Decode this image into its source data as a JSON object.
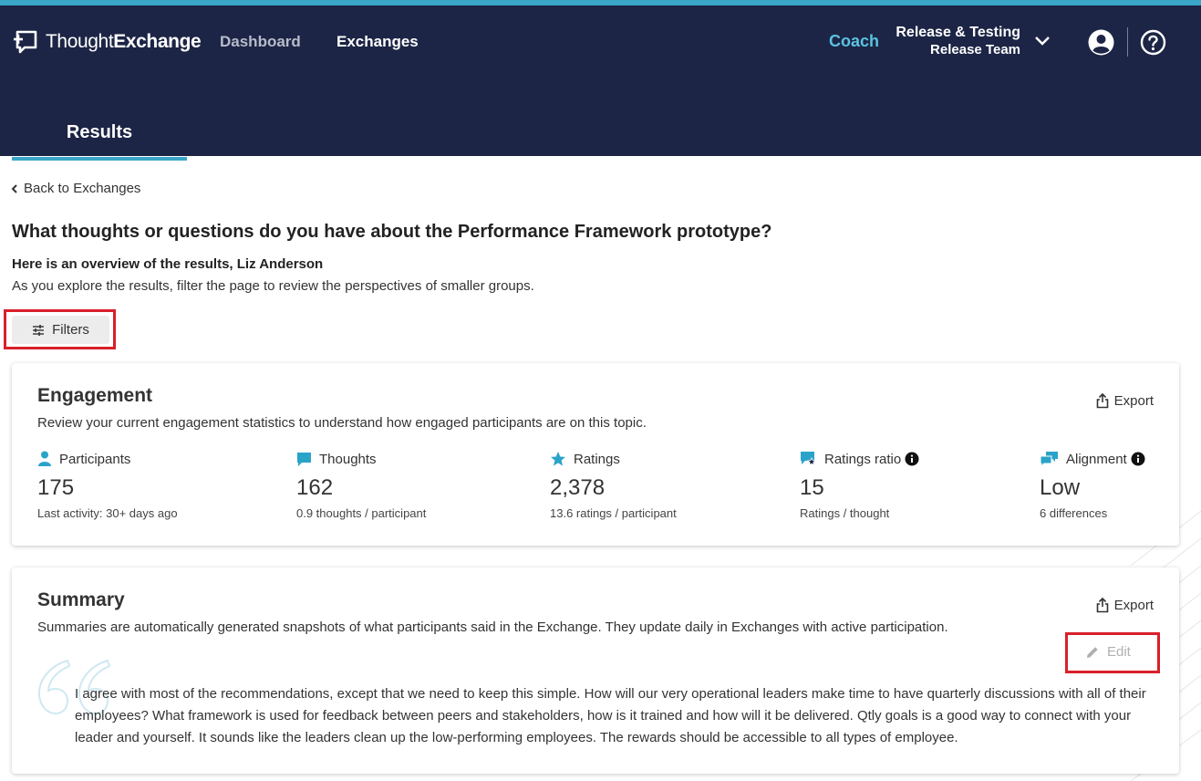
{
  "colors": {
    "header_bg": "#1c2545",
    "accent": "#3aa7c9",
    "coach": "#5cc1e0",
    "icon_accent": "#2aa3c9",
    "highlight_red": "#d9202a"
  },
  "header": {
    "logo_light": "Thought",
    "logo_bold": "Exchange",
    "nav": {
      "dashboard": "Dashboard",
      "exchanges": "Exchanges"
    },
    "coach": "Coach",
    "org_name": "Release & Testing",
    "team_name": "Release Team",
    "icons": {
      "logo": "thoughtexchange-logo-icon",
      "chevron": "chevron-down-icon",
      "user": "user-circle-icon",
      "help": "help-circle-icon"
    }
  },
  "tabs": {
    "results": "Results"
  },
  "back_link": "Back to Exchanges",
  "page_title": "What thoughts or questions do you have about the Performance Framework prototype?",
  "overview": {
    "title": "Here is an overview of the results, Liz Anderson",
    "subtitle": "As you explore the results, filter the page to review the perspectives of smaller groups."
  },
  "filters_label": "Filters",
  "engagement": {
    "title": "Engagement",
    "description": "Review your current engagement statistics to understand how engaged participants are on this topic.",
    "export_label": "Export",
    "stats": [
      {
        "label": "Participants",
        "value": "175",
        "sub": "Last activity: 30+ days ago",
        "icon": "person-icon"
      },
      {
        "label": "Thoughts",
        "value": "162",
        "sub": "0.9 thoughts / participant",
        "icon": "speech-bubble-icon"
      },
      {
        "label": "Ratings",
        "value": "2,378",
        "sub": "13.6 ratings / participant",
        "icon": "star-icon"
      },
      {
        "label": "Ratings ratio",
        "value": "15",
        "sub": "Ratings / thought",
        "icon": "ratings-ratio-icon"
      },
      {
        "label": "Alignment",
        "value": "Low",
        "sub": "6 differences",
        "icon": "alignment-icon"
      }
    ]
  },
  "summary": {
    "title": "Summary",
    "description": "Summaries are automatically generated snapshots of what participants said in the Exchange. They update daily in Exchanges with active participation.",
    "export_label": "Export",
    "edit_label": "Edit",
    "quote": "I agree with most of the recommendations, except that we need to keep this simple. How will our very operational leaders make time to have quarterly discussions with all of their employees? What framework is used for feedback between peers and stakeholders, how is it trained and how will it be delivered. Qtly goals is a good way to connect with your leader and yourself. It sounds like the leaders clean up the low-performing employees. The rewards should be accessible to all types of employee."
  }
}
